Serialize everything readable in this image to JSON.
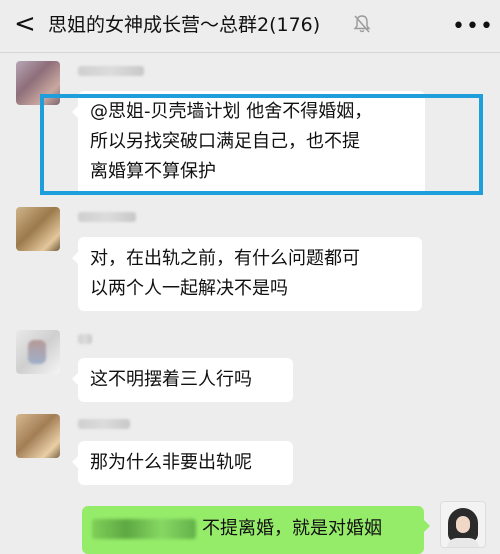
{
  "header": {
    "back_icon": "chevron-left-icon",
    "title": "思姐的女神成长营～总群2(176)",
    "mute_icon": "bell-muted-icon",
    "more_icon": "ellipsis-icon"
  },
  "messages": [
    {
      "lines": [
        "@思姐-贝壳墙计划  他舍不得婚姻，",
        "所以另找突破口满足自己，也不提",
        "离婚算不算保护"
      ]
    },
    {
      "lines": [
        "对，在出轨之前，有什么问题都可",
        "以两个人一起解决不是吗"
      ]
    },
    {
      "lines": [
        "这不明摆着三人行吗"
      ]
    },
    {
      "lines": [
        "那为什么非要出轨呢"
      ]
    }
  ],
  "my_message": {
    "text": "不提离婚，就是对婚姻"
  },
  "colors": {
    "highlight_border": "#1e9fdc",
    "my_bubble": "#95ec69",
    "background": "#ededed"
  }
}
